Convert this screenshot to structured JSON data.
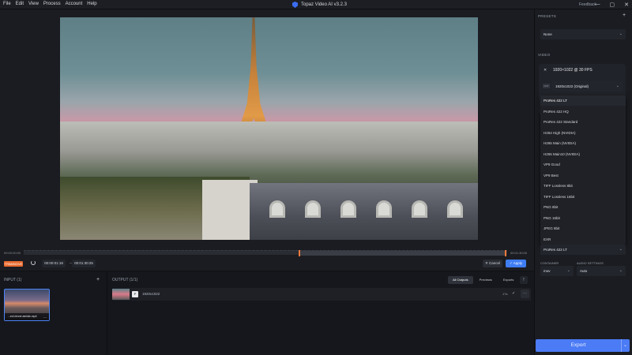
{
  "menu": [
    "File",
    "Edit",
    "View",
    "Process",
    "Account",
    "Help"
  ],
  "app_title": "Topaz Video AI  v3.2.3",
  "feedback": "Feedback",
  "window_controls": [
    "—",
    "▢",
    "✕"
  ],
  "timeline": {
    "start": "00:00:00:00",
    "end": "00:01:30:00"
  },
  "controls": {
    "trim_label": "TRIM/MOVE",
    "in_time": "00:00:01:18",
    "sep": "—",
    "out_time": "00:01:30:25",
    "cancel": "✕ Cancel",
    "apply": "✓ Apply"
  },
  "input": {
    "header": "INPUT (1)",
    "plus": "+",
    "file_label": "...ect drone aerials.mp4",
    "more": "⋯"
  },
  "output": {
    "header": "OUTPUT (1/1)",
    "tabs": [
      "All Outputs",
      "Previews",
      "Exports"
    ],
    "info": "!",
    "row": {
      "badge": "P",
      "resolution": "1920x1022",
      "time": "17s",
      "check": "✓",
      "more": "⋯"
    }
  },
  "right": {
    "presets_label": "PRESETS",
    "presets_value": "None",
    "video_label": "VIDEO",
    "res_label": "1920×1022 @ 30 FPS",
    "tag": "OUT",
    "resolution_select": "1920x1022 (Original)",
    "container_label": "CONTAINER",
    "audio_label": "AUDIO SETTINGS",
    "container_value": "mov",
    "audio_value": "Auto",
    "codec_value": "ProRes 422 LT",
    "export": "Export"
  },
  "dropdown": [
    "ProRes 422 LT",
    "ProRes 422 HQ",
    "ProRes 422 Standard",
    "H264 High (NVIDIA)",
    "H265 Main (NVIDIA)",
    "H265 Main10 (NVIDIA)",
    "VP9 Good",
    "VP9 Best",
    "TIFF Lossless 8bit",
    "TIFF Lossless 16bit",
    "PNG 8bit",
    "PNG 16bit",
    "JPEG 8bit",
    "EXR"
  ],
  "colors": {
    "accent": "#3f7df3",
    "trim": "#e8692e",
    "playhead": "#f07a3c"
  }
}
